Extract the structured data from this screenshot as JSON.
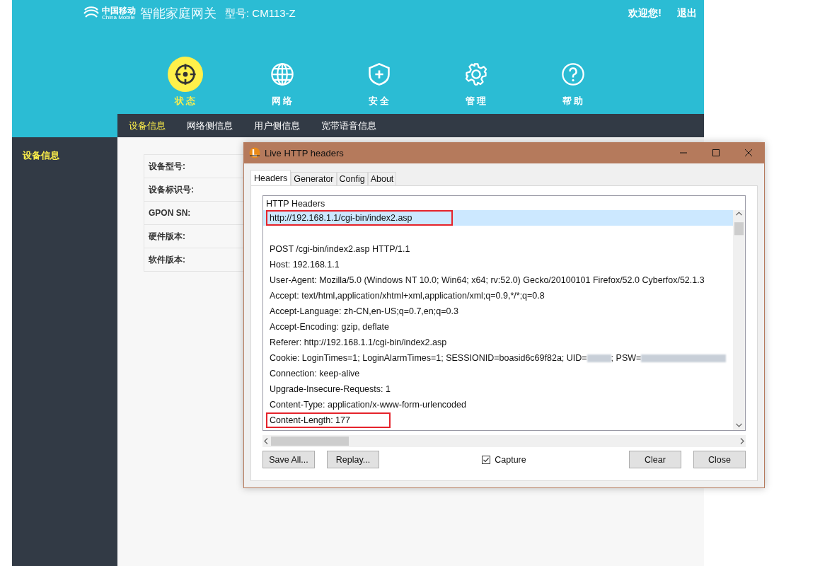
{
  "header": {
    "brand_cn": "中国移动",
    "brand_en": "China Mobile",
    "product": "智能家庭网关",
    "model": "型号: CM113-Z",
    "welcome": "欢迎您!",
    "logout": "退出"
  },
  "nav": [
    {
      "kind": "crosshair",
      "label": "状 态",
      "selected": true
    },
    {
      "kind": "globe",
      "label": "网 络",
      "selected": false
    },
    {
      "kind": "shield",
      "label": "安 全",
      "selected": false
    },
    {
      "kind": "gear",
      "label": "管 理",
      "selected": false
    },
    {
      "kind": "help",
      "label": "帮 助",
      "selected": false
    }
  ],
  "subnav": [
    {
      "label": "设备信息",
      "selected": true
    },
    {
      "label": "网络侧信息",
      "selected": false
    },
    {
      "label": "用户侧信息",
      "selected": false
    },
    {
      "label": "宽带语音信息",
      "selected": false
    }
  ],
  "sidebar": {
    "items": [
      {
        "label": "设备信息",
        "selected": true
      }
    ]
  },
  "device_table": {
    "rows": [
      "设备型号:",
      "设备标识号:",
      "GPON SN:",
      "硬件版本:",
      "软件版本:"
    ]
  },
  "dialog": {
    "title": "Live HTTP headers",
    "tabs": [
      {
        "label": "Headers",
        "selected": true
      },
      {
        "label": "Generator",
        "selected": false
      },
      {
        "label": "Config",
        "selected": false
      },
      {
        "label": "About",
        "selected": false
      }
    ],
    "group_label": "HTTP Headers",
    "lines": [
      {
        "kind": "text",
        "text": "http://192.168.1.1/cgi-bin/index2.asp",
        "selected": true,
        "annotated": true
      },
      {
        "kind": "blank"
      },
      {
        "kind": "text",
        "text": "POST /cgi-bin/index2.asp HTTP/1.1",
        "selected": false,
        "annotated": false
      },
      {
        "kind": "text",
        "text": "Host: 192.168.1.1",
        "selected": false,
        "annotated": false
      },
      {
        "kind": "text",
        "text": "User-Agent: Mozilla/5.0 (Windows NT 10.0; Win64; x64; rv:52.0) Gecko/20100101 Firefox/52.0 Cyberfox/52.1.3",
        "selected": false,
        "annotated": false
      },
      {
        "kind": "text",
        "text": "Accept: text/html,application/xhtml+xml,application/xml;q=0.9,*/*;q=0.8",
        "selected": false,
        "annotated": false
      },
      {
        "kind": "text",
        "text": "Accept-Language: zh-CN,en-US;q=0.7,en;q=0.3",
        "selected": false,
        "annotated": false
      },
      {
        "kind": "text",
        "text": "Accept-Encoding: gzip, deflate",
        "selected": false,
        "annotated": false
      },
      {
        "kind": "text",
        "text": "Referer: http://192.168.1.1/cgi-bin/index2.asp",
        "selected": false,
        "annotated": false
      },
      {
        "kind": "redacted",
        "parts": [
          "Cookie: LoginTimes=1; LoginAlarmTimes=1; SESSIONID=boasid6c69f82a; UID=",
          "; PSW="
        ],
        "selected": false,
        "annotated": false
      },
      {
        "kind": "text",
        "text": "Connection: keep-alive",
        "selected": false,
        "annotated": false
      },
      {
        "kind": "text",
        "text": "Upgrade-Insecure-Requests: 1",
        "selected": false,
        "annotated": false
      },
      {
        "kind": "text",
        "text": "Content-Type: application/x-www-form-urlencoded",
        "selected": false,
        "annotated": false
      },
      {
        "kind": "text",
        "text": "Content-Length: 177",
        "selected": false,
        "annotated": true
      }
    ],
    "buttons_left": [
      "Save All...",
      "Replay..."
    ],
    "capture": {
      "label": "Capture",
      "checked": true
    },
    "buttons_right": [
      "Clear",
      "Close"
    ]
  }
}
